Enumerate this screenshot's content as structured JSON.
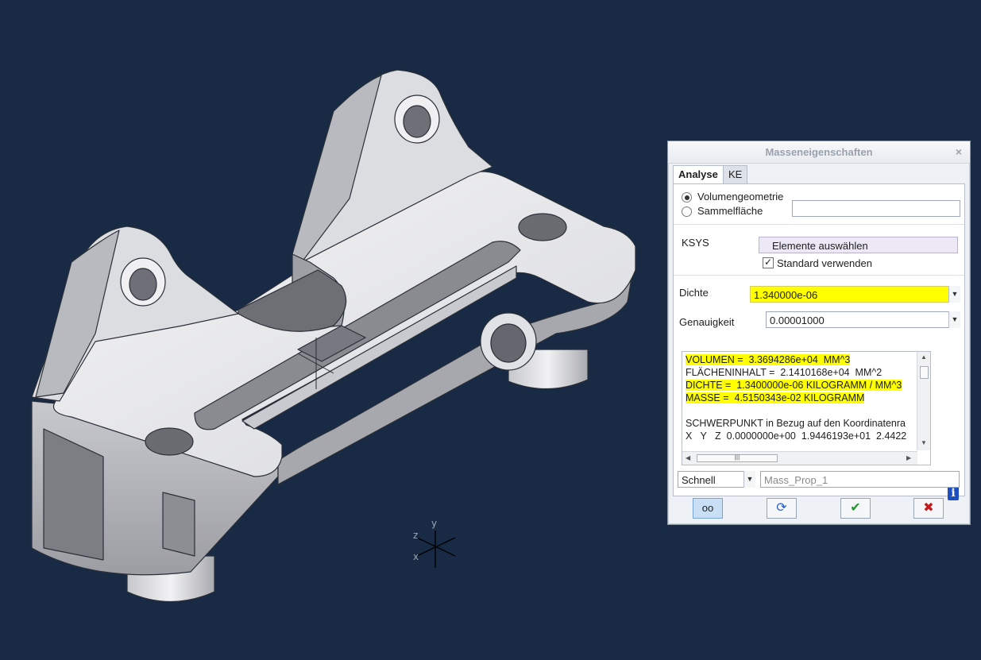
{
  "viewport": {
    "background": "#182a44",
    "axis_labels": {
      "z": "z",
      "y": "y",
      "x": "x"
    }
  },
  "dialog": {
    "title": "Masseneigenschaften",
    "close_icon": "close-icon",
    "tabs": [
      {
        "label": "Analyse",
        "active": true
      },
      {
        "label": "KE",
        "active": false
      }
    ],
    "geometry": {
      "options": [
        {
          "label": "Volumengeometrie",
          "selected": true
        },
        {
          "label": "Sammelfläche",
          "selected": false
        }
      ],
      "surface_value": ""
    },
    "ksys": {
      "label": "KSYS",
      "select_button": "Elemente auswählen",
      "default_checkbox_label": "Standard verwenden",
      "default_checked": true
    },
    "density": {
      "label": "Dichte",
      "value": "1.340000e-06"
    },
    "accuracy": {
      "label": "Genauigkeit",
      "value": "0.00001000"
    },
    "results": {
      "lines": [
        {
          "text": "VOLUMEN =  3.3694286e+04  MM^3",
          "highlight": true
        },
        {
          "text": "FLÄCHENINHALT =  2.1410168e+04  MM^2",
          "highlight": false
        },
        {
          "text": "DICHTE =  1.3400000e-06 KILOGRAMM / MM^3",
          "highlight": true
        },
        {
          "text": "MASSE =  4.5150343e-02 KILOGRAMM",
          "highlight": true
        },
        {
          "text": "",
          "highlight": false
        },
        {
          "text": "SCHWERPUNKT in Bezug auf den Koordinatenra",
          "highlight": false
        },
        {
          "text": "X   Y   Z  0.0000000e+00  1.9446193e+01  2.4422",
          "highlight": false
        }
      ]
    },
    "mode": {
      "value": "Schnell",
      "name_value": "Mass_Prop_1"
    },
    "buttons": [
      {
        "name": "preview-button",
        "icon": "glasses-icon",
        "glyph": "👓"
      },
      {
        "name": "repeat-button",
        "icon": "refresh-icon",
        "glyph": "⟳"
      },
      {
        "name": "ok-button",
        "icon": "checkmark-icon",
        "glyph": "✔"
      },
      {
        "name": "cancel-button",
        "icon": "cross-icon",
        "glyph": "✖"
      }
    ],
    "colors": {
      "highlight": "#ffff00",
      "ok": "#1a9a2a",
      "cancel": "#c41a1a",
      "info": "#1f4fbf"
    }
  }
}
